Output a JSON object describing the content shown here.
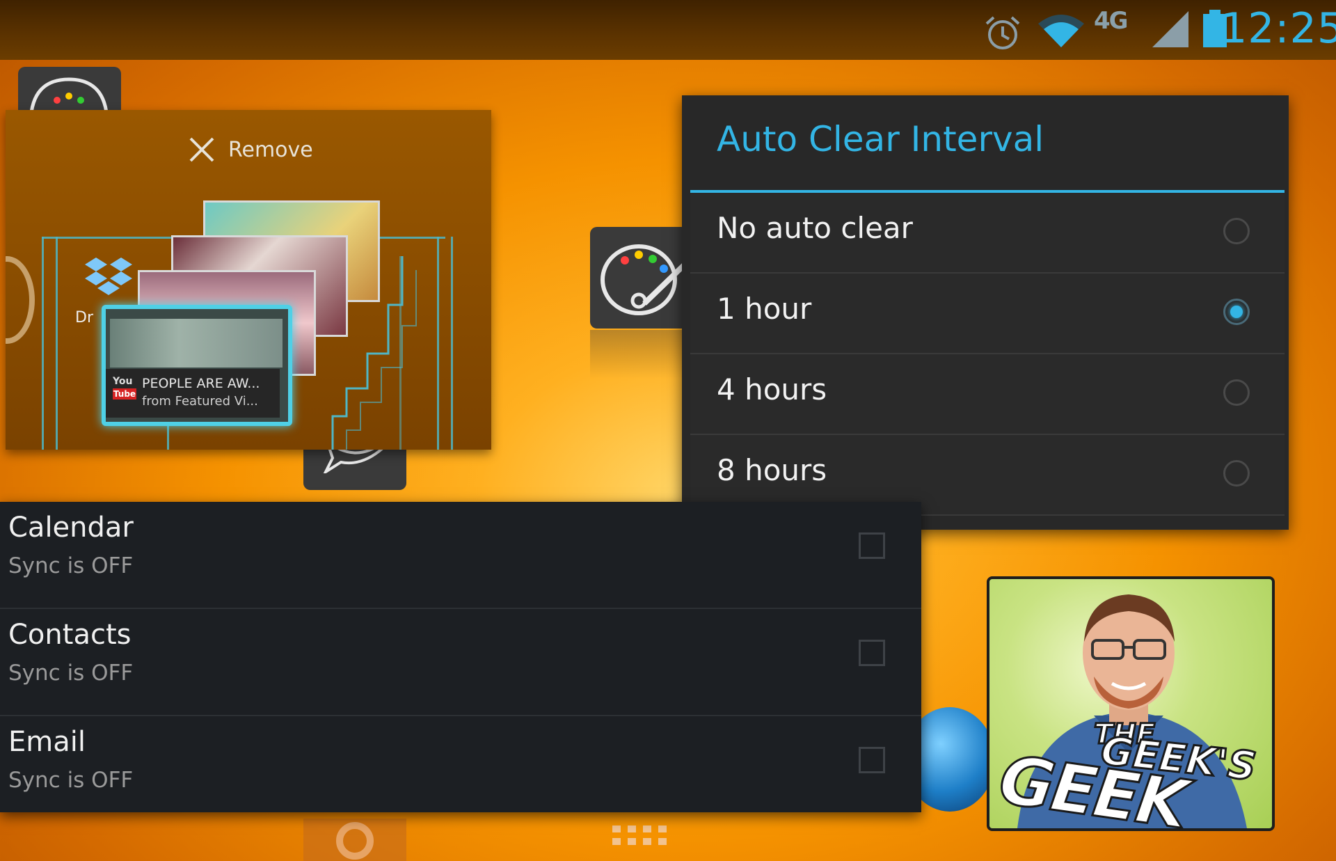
{
  "status_bar": {
    "time": "12:25",
    "network": "4G",
    "icons": [
      "alarm-icon",
      "wifi-icon",
      "signal-icon",
      "battery-icon"
    ],
    "accent": "#33b5e5"
  },
  "widget_panel": {
    "remove_label": "Remove",
    "partial_label": "Dr",
    "video_title": "PEOPLE ARE AW...",
    "video_subtitle": "from Featured Vi..."
  },
  "dialog": {
    "title": "Auto Clear Interval",
    "options": [
      {
        "label": "No auto clear",
        "selected": false
      },
      {
        "label": "1 hour",
        "selected": true
      },
      {
        "label": "4 hours",
        "selected": false
      },
      {
        "label": "8 hours",
        "selected": false
      }
    ]
  },
  "sync_list": {
    "items": [
      {
        "title": "Calendar",
        "status": "Sync is OFF",
        "checked": false
      },
      {
        "title": "Contacts",
        "status": "Sync is OFF",
        "checked": false
      },
      {
        "title": "Email",
        "status": "Sync is OFF",
        "checked": false
      }
    ]
  },
  "logo": {
    "line1": "THE",
    "line2": "GEEK'S",
    "line3": "GEEK"
  }
}
